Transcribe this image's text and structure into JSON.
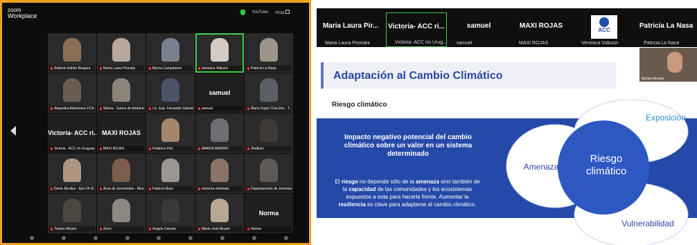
{
  "zoom": {
    "brand": "zoom",
    "app": "Workplace",
    "youtube": "YouTube",
    "view": "Vista"
  },
  "gallery": [
    {
      "name": "Roberto Adrián Bergara",
      "type": "video",
      "color": "#8a6f55"
    },
    {
      "name": "María Laura Pirovani",
      "type": "video",
      "color": "#b8a79a"
    },
    {
      "name": "Myrna Campoleoni",
      "type": "video",
      "color": "#7a8190"
    },
    {
      "name": "Verónica Vidiuzzi",
      "type": "video",
      "color": "#d5cbc3",
      "active": true
    },
    {
      "name": "Patricia La Nasa",
      "type": "video",
      "color": "#9c9588"
    },
    {
      "name": "Alejandra Altamirano FCA-U...",
      "type": "video",
      "color": "#6b5c52"
    },
    {
      "name": "Silvina - Subse de Ambient...",
      "type": "video",
      "color": "#8e8378"
    },
    {
      "name": "Lic. Esp. Fernando Gabriel F...",
      "type": "video",
      "color": "#4a5568"
    },
    {
      "name": "samuel",
      "type": "text",
      "big": "samuel"
    },
    {
      "name": "Mario Dupin Chia Eko - T...",
      "type": "video",
      "color": "#5b5f66"
    },
    {
      "name": "Victoria - ACC río Uruguay",
      "type": "text",
      "big": "Victoria- ACC ri..."
    },
    {
      "name": "MAXI ROJAS",
      "type": "text",
      "big": "MAXI ROJAS"
    },
    {
      "name": "Federico Flor",
      "type": "video",
      "color": "#a3886e"
    },
    {
      "name": "AMADA MARINO",
      "type": "video",
      "color": "#6e6f74"
    },
    {
      "name": "Shelluzz",
      "type": "video",
      "color": "#3f3a36"
    },
    {
      "name": "Deme Benitez - Epri 24 El SO...",
      "type": "video",
      "color": "#b09580"
    },
    {
      "name": "Área de Juventudes - Munic...",
      "type": "video",
      "color": "#7b5e4c"
    },
    {
      "name": "Fabricio Brau",
      "type": "video",
      "color": "#9b9690"
    },
    {
      "name": "motoroa motorata",
      "type": "video",
      "color": "#8a7468"
    },
    {
      "name": "Departamento de Juventud",
      "type": "video",
      "color": "#5e5a55"
    },
    {
      "name": "Tiziano Ricard",
      "type": "video",
      "color": "#4c4640"
    },
    {
      "name": "Zorro",
      "type": "video",
      "color": "#8c8882"
    },
    {
      "name": "Angela Carrola",
      "type": "video",
      "color": "#3a3a3a"
    },
    {
      "name": "María José Alcaire",
      "type": "video",
      "color": "#b9a796"
    },
    {
      "name": "Norma",
      "type": "text",
      "big": "Norma"
    }
  ],
  "strip": [
    {
      "big": "Maria Laura Pir...",
      "small": "Maria Laura Pirovani"
    },
    {
      "big": "Victoria- ACC ri...",
      "small": "Victoria- ACC río Urug...",
      "active": true
    },
    {
      "big": "samuel",
      "small": "samuel"
    },
    {
      "big": "MAXI ROJAS",
      "small": "MAXI ROJAS"
    },
    {
      "big": "",
      "small": "Veronica Vidiuzzi"
    },
    {
      "big": "Patricia La Nasa",
      "small": "Patricia La Nasa"
    }
  ],
  "acc_logo": "ACC",
  "presenter_name": "Tamara Acosta",
  "slide": {
    "title": "Adaptación al Cambio Climático",
    "risk_label": "Riesgo climático",
    "heading": "Impacto negativo potencial del cambio climático sobre un valor en un sistema determinado",
    "body_1": "El ",
    "body_riesgo": "riesgo",
    "body_2": " no depende sólo de la ",
    "body_amenaza": "amenaza",
    "body_3": " sino también de la ",
    "body_capacidad": "capacidad",
    "body_4": " de las comunidades y los ecosistemas expuestos a esta para hacerle frente. Aumentar la ",
    "body_resiliencia": "resiliencia",
    "body_5": " es clave para adaptarse al cambio climático.",
    "venn_exposicion": "Exposición",
    "venn_amenaza": "Amenaza",
    "venn_riesgo_1": "Riesgo",
    "venn_riesgo_2": "climático",
    "venn_vulnerabilidad": "Vulnerabilidad"
  },
  "colors": {
    "frame": "#f0a020",
    "band": "#2549a8",
    "title": "#2a44a8",
    "active": "#3ecf4a"
  }
}
